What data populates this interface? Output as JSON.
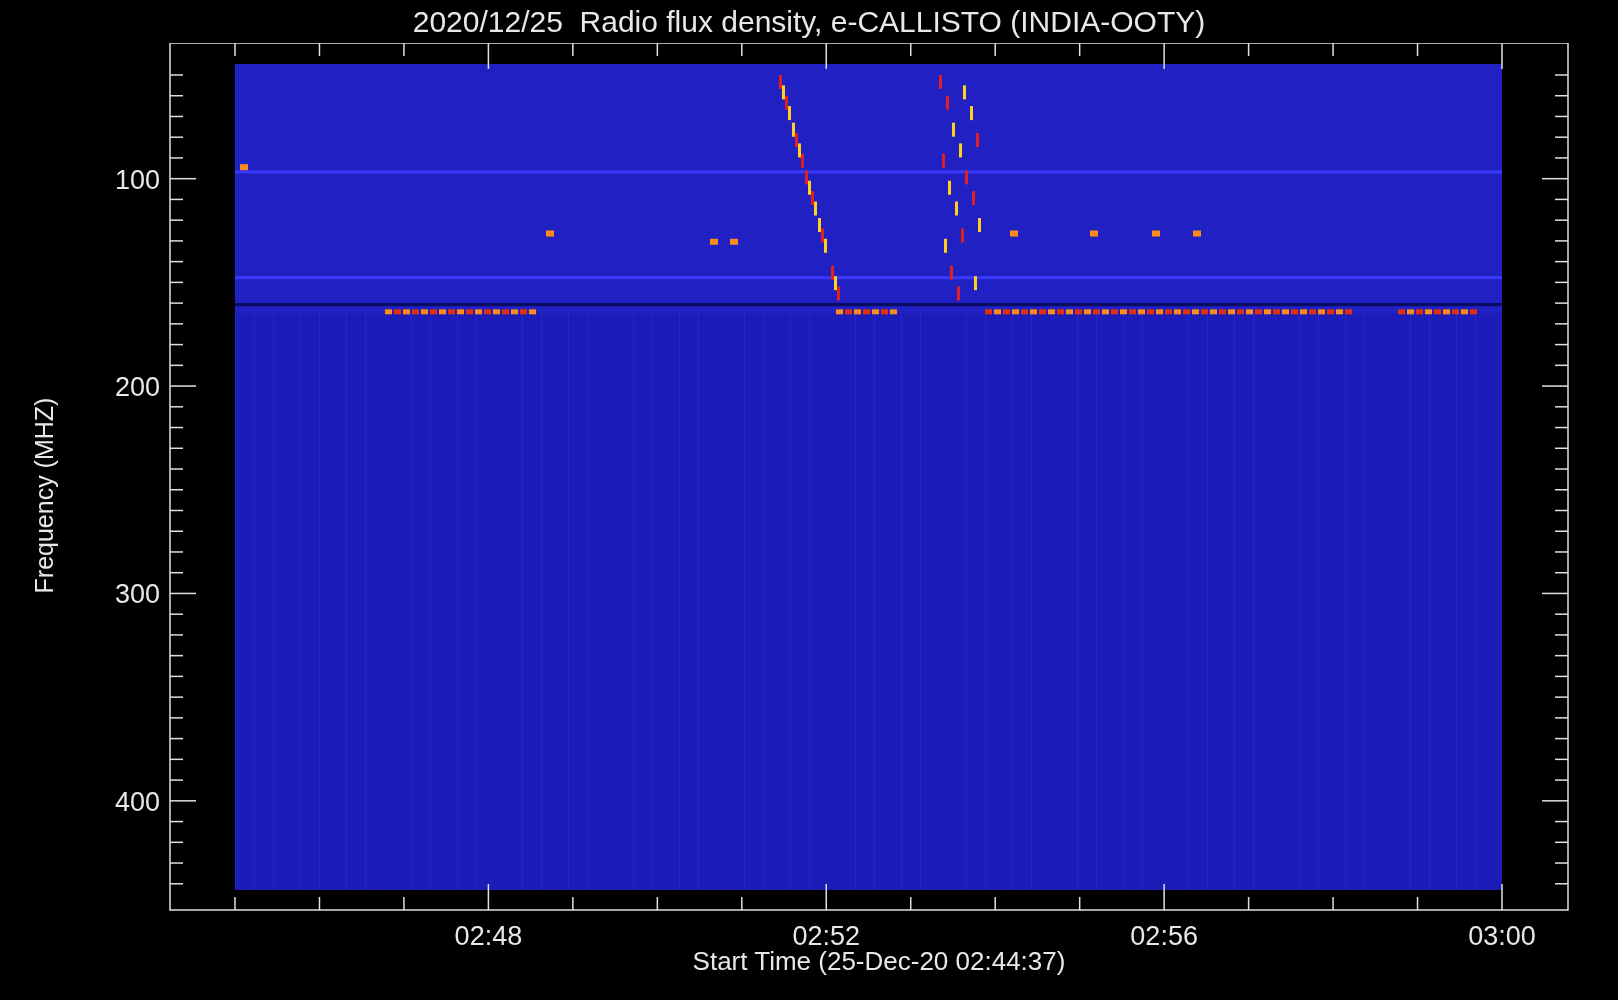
{
  "plot": {
    "title": "2020/12/25  Radio flux density, e-CALLISTO (INDIA-OOTY)",
    "ylabel": "Frequency (MHZ)",
    "xlabel": "Start Time (25-Dec-20 02:44:37)",
    "yticks": [
      "100",
      "200",
      "300",
      "400"
    ],
    "xticks": [
      "02:48",
      "02:52",
      "02:56",
      "03:00"
    ]
  }
}
